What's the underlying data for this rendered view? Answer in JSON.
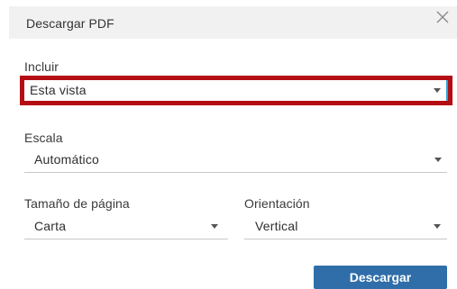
{
  "dialog": {
    "title": "Descargar PDF",
    "close_icon": "close-icon"
  },
  "include": {
    "label": "Incluir",
    "value": "Esta vista"
  },
  "scale": {
    "label": "Escala",
    "value": "Automático"
  },
  "page_size": {
    "label": "Tamaño de página",
    "value": "Carta"
  },
  "orientation": {
    "label": "Orientación",
    "value": "Vertical"
  },
  "actions": {
    "download_label": "Descargar"
  },
  "colors": {
    "header_bg": "#f1f1f1",
    "highlight_border": "#b40d14",
    "focus_accent": "#2aa4e0",
    "button_bg": "#2f6ea9"
  }
}
